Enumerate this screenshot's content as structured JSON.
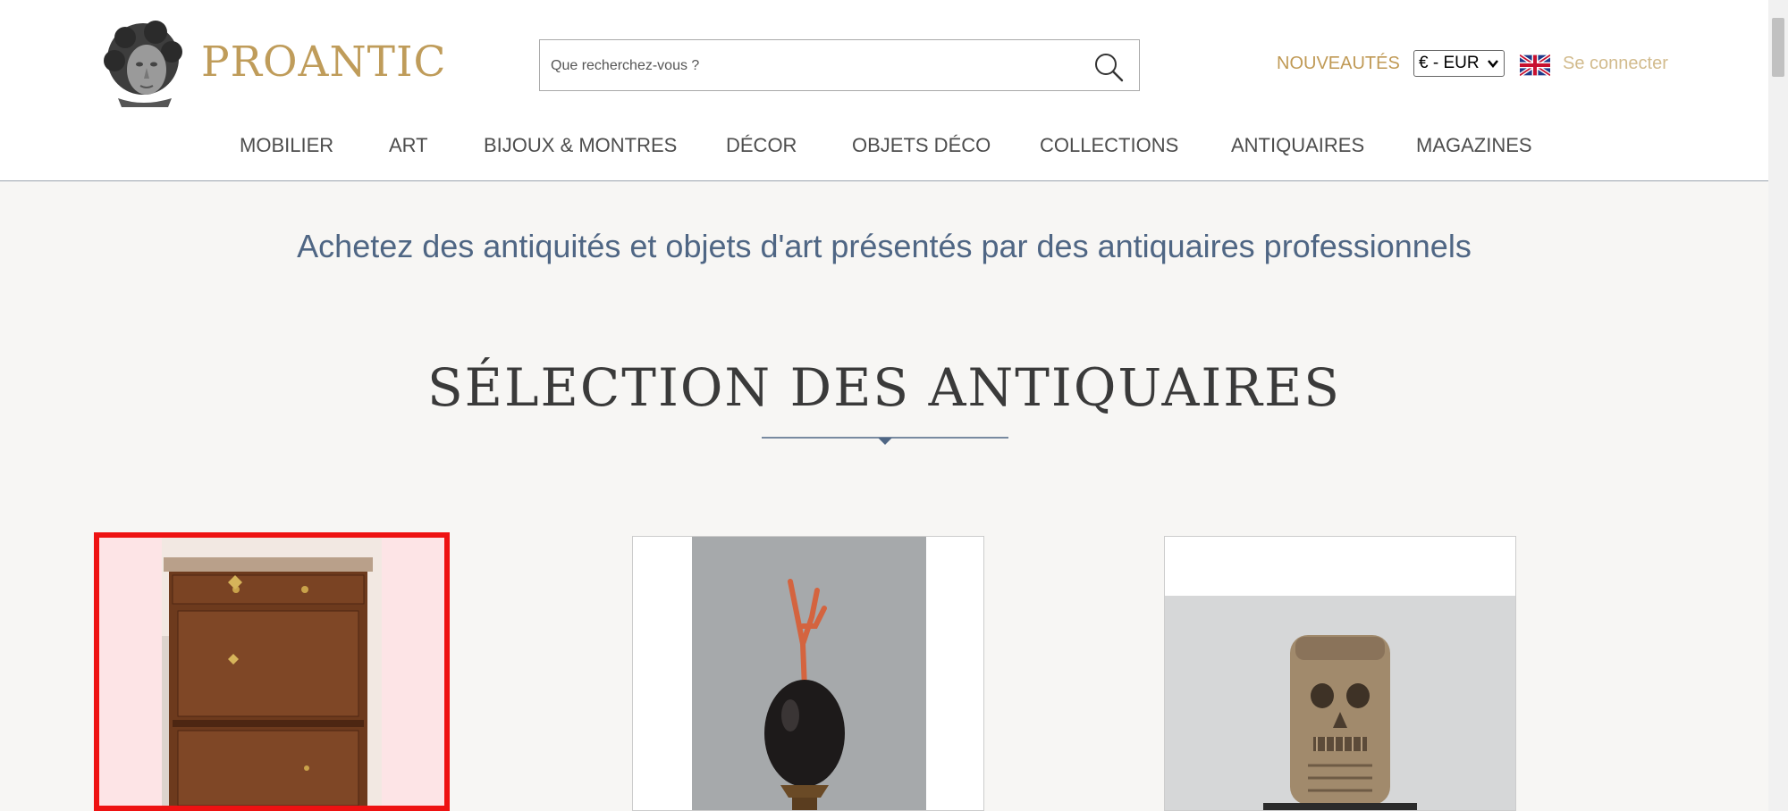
{
  "header": {
    "logo_text": "PROANTIC",
    "search_placeholder": "Que recherchez-vous ?",
    "nouveautes": "NOUVEAUTÉS",
    "currency": "€ - EUR",
    "login": "Se connecter"
  },
  "nav": {
    "items": [
      "MOBILIER",
      "ART",
      "BIJOUX & MONTRES",
      "DÉCOR",
      "OBJETS DÉCO",
      "COLLECTIONS",
      "ANTIQUAIRES",
      "MAGAZINES"
    ]
  },
  "main": {
    "tagline": "Achetez des antiquités et objets d'art présentés par des antiquaires professionnels",
    "section_title": "SÉLECTION DES ANTIQUAIRES"
  },
  "colors": {
    "brand_gold": "#bf9c5a",
    "tagline_blue": "#4f6684",
    "selection_red": "#ee1212",
    "page_bg": "#f7f6f4"
  }
}
